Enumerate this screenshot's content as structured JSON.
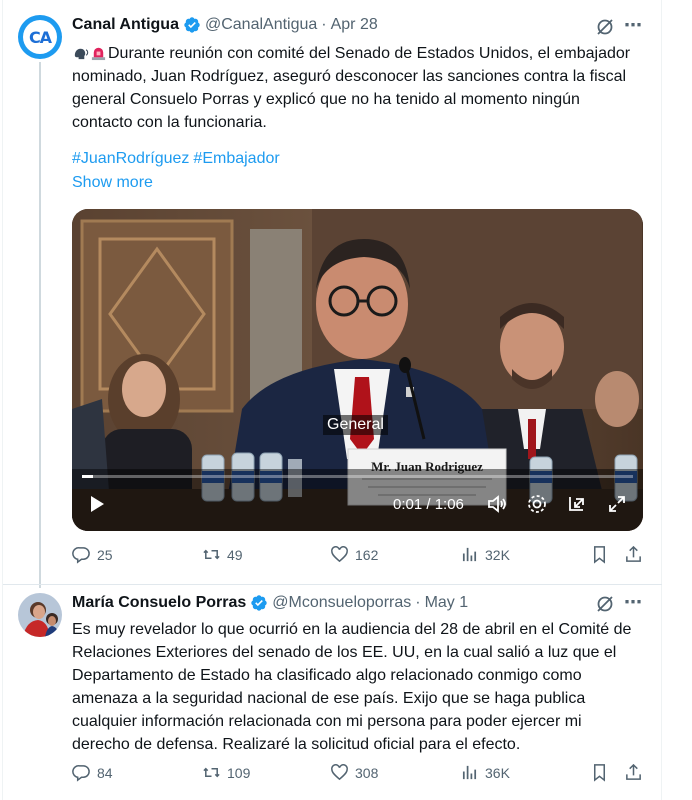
{
  "tweets": [
    {
      "author": {
        "name": "Canal Antigua",
        "handle": "@CanalAntigua",
        "avatar_text": "CA"
      },
      "date": "Apr 28",
      "separator": "·",
      "emojis": [
        "speaking-head-emoji",
        "police-light-emoji"
      ],
      "text": "Durante reunión con comité del Senado de Estados Unidos, el embajador nominado, Juan Rodríguez, aseguró desconocer las sanciones contra la fiscal general Consuelo Porras y explicó que no ha tenido al momento ningún contacto con la funcionaria.",
      "hashtags": [
        "#JuanRodríguez",
        "#Embajador"
      ],
      "show_more": "Show more",
      "video": {
        "caption": "General",
        "nameplate": "Mr. Juan Rodriguez",
        "nameplate_sub": "Ambassador Extraordinary and Plenipotentiary of the United States of America to the Republic of Guatemala",
        "time": "0:01 / 1:06",
        "progress": 0.02
      },
      "stats": {
        "replies": "25",
        "retweets": "49",
        "likes": "162",
        "views": "32K"
      }
    },
    {
      "author": {
        "name": "María Consuelo Porras",
        "handle": "@Mconsueloporras"
      },
      "date": "May 1",
      "separator": "·",
      "text": "Es muy revelador lo que ocurrió en la audiencia del 28 de abril en el Comité de Relaciones Exteriores del senado de los EE. UU, en la cual salió a luz que el Departamento de Estado ha clasificado algo relacionado conmigo como amenaza a la seguridad nacional de ese país. Exijo que se haga publica cualquier información relacionada con mi persona para poder ejercer mi derecho de defensa. Realizaré la solicitud oficial para el efecto.",
      "stats": {
        "replies": "84",
        "retweets": "109",
        "likes": "308",
        "views": "36K"
      }
    }
  ],
  "colors": {
    "accent": "#1d9bf0",
    "text": "#0f1419",
    "muted": "#536471",
    "verified": "#1d9bf0"
  }
}
